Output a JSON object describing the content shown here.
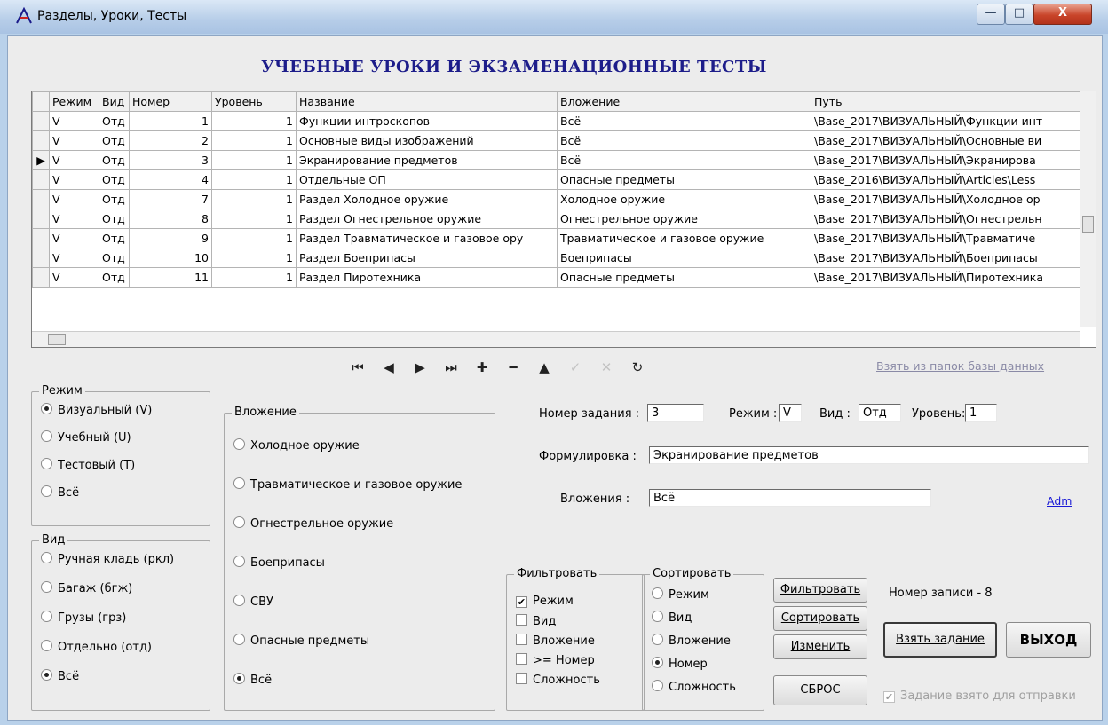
{
  "window": {
    "title": "Разделы, Уроки, Тесты",
    "min": "—",
    "max": "□",
    "close": "X"
  },
  "heading": "УЧЕБНЫЕ УРОКИ И ЭКЗАМЕНАЦИОННЫЕ ТЕСТЫ",
  "table": {
    "columns": [
      "Режим",
      "Вид",
      "Номер",
      "Уровень",
      "Название",
      "Вложение",
      "Путь"
    ],
    "rows": [
      [
        "V",
        "Отд",
        "1",
        "1",
        "Функции интроскопов",
        "Всё",
        "\\Base_2017\\ВИЗУАЛЬНЫЙ\\Функции инт"
      ],
      [
        "V",
        "Отд",
        "2",
        "1",
        "Основные виды изображений",
        "Всё",
        "\\Base_2017\\ВИЗУАЛЬНЫЙ\\Основные ви"
      ],
      [
        "V",
        "Отд",
        "3",
        "1",
        "Экранирование предметов",
        "Всё",
        "\\Base_2017\\ВИЗУАЛЬНЫЙ\\Экранирова"
      ],
      [
        "V",
        "Отд",
        "4",
        "1",
        "Отдельные ОП",
        "Опасные предметы",
        "\\Base_2016\\ВИЗУАЛЬНЫЙ\\Articles\\Less"
      ],
      [
        "V",
        "Отд",
        "7",
        "1",
        "Раздел Холодное оружие",
        "Холодное оружие",
        "\\Base_2017\\ВИЗУАЛЬНЫЙ\\Холодное ор"
      ],
      [
        "V",
        "Отд",
        "8",
        "1",
        "Раздел Огнестрельное оружие",
        "Огнестрельное оружие",
        "\\Base_2017\\ВИЗУАЛЬНЫЙ\\Огнестрельн"
      ],
      [
        "V",
        "Отд",
        "9",
        "1",
        "Раздел Травматическое и газовое ору",
        "Травматическое и газовое оружие",
        "\\Base_2017\\ВИЗУАЛЬНЫЙ\\Травматиче"
      ],
      [
        "V",
        "Отд",
        "10",
        "1",
        "Раздел Боеприпасы",
        "Боеприпасы",
        "\\Base_2017\\ВИЗУАЛЬНЫЙ\\Боеприпасы"
      ],
      [
        "V",
        "Отд",
        "11",
        "1",
        "Раздел Пиротехника",
        "Опасные предметы",
        "\\Base_2017\\ВИЗУАЛЬНЫЙ\\Пиротехника"
      ]
    ],
    "current_row_marker": "▶"
  },
  "nav": {
    "first": "⏮",
    "prev": "◀",
    "next": "▶",
    "last": "⏭",
    "add": "✚",
    "delete": "━",
    "edit": "▲",
    "post": "✓",
    "cancel": "✕",
    "refresh": "↻"
  },
  "take_from_folder_link": "Взять из папок базы данных",
  "rezhim": {
    "title": "Режим",
    "options": [
      "Визуальный (V)",
      "Учебный (U)",
      "Тестовый (T)",
      "Всё"
    ],
    "selected": "Визуальный (V)"
  },
  "vid": {
    "title": "Вид",
    "options": [
      "Ручная кладь (ркл)",
      "Багаж (бгж)",
      "Грузы (грз)",
      "Отдельно (отд)",
      "Всё"
    ],
    "selected": "Всё"
  },
  "vlozhenie": {
    "title": "Вложение",
    "options": [
      "Холодное оружие",
      "Травматическое и газовое оружие",
      "Огнестрельное оружие",
      "Боеприпасы",
      "СВУ",
      "Опасные предметы",
      "Всё"
    ],
    "selected": "Всё"
  },
  "form": {
    "nomer_label": "Номер задания :",
    "nomer_value": "3",
    "rezhim_label": "Режим :",
    "rezhim_value": "V",
    "vid_label": "Вид :",
    "vid_value": "Отд",
    "uroven_label": "Уровень:",
    "uroven_value": "1",
    "formulirovka_label": "Формулировка :",
    "formulirovka_value": "Экранирование предметов",
    "vlozheniya_label": "Вложения :",
    "vlozheniya_value": "Всё",
    "adm_link": "Adm"
  },
  "filter": {
    "title": "Фильтровать",
    "options": [
      "Режим",
      "Вид",
      "Вложение",
      ">= Номер",
      "Сложность"
    ],
    "checked": [
      "Режим"
    ],
    "check_mark": "✔"
  },
  "sort": {
    "title": "Сортировать",
    "options": [
      "Режим",
      "Вид",
      "Вложение",
      "Номер",
      "Сложность"
    ],
    "selected": "Номер"
  },
  "buttons": {
    "filter": "Фильтровать",
    "sort": "Сортировать",
    "change": "Изменить",
    "reset": "СБРОС",
    "take_task": "Взять задание",
    "exit": "ВЫХОД"
  },
  "record_number_label": "Номер записи -  8",
  "task_taken_checkbox": "Задание взято для отправки"
}
